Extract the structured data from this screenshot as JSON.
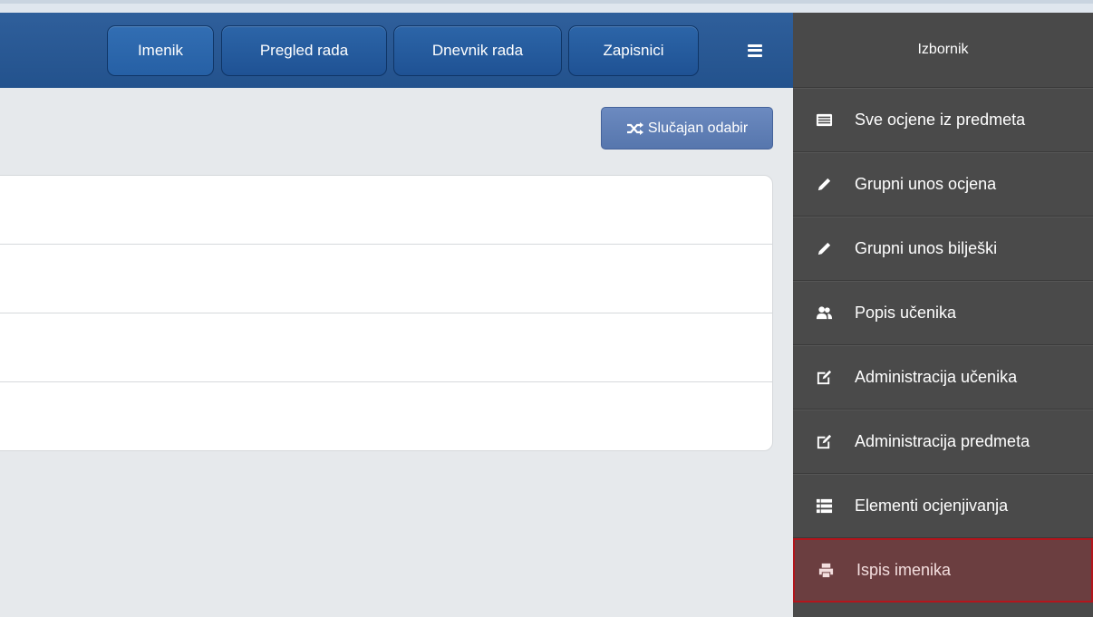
{
  "nav": {
    "buttons": [
      {
        "label": "Imenik"
      },
      {
        "label": "Pregled rada"
      },
      {
        "label": "Dnevnik rada"
      },
      {
        "label": "Zapisnici"
      }
    ],
    "menu_icon": "hamburger-icon"
  },
  "toolbar": {
    "random_label": "Slučajan odabir",
    "random_icon": "shuffle-icon"
  },
  "sidebar": {
    "title": "Izbornik",
    "items": [
      {
        "label": "Sve ocjene iz predmeta",
        "icon": "list-alt-icon"
      },
      {
        "label": "Grupni unos ocjena",
        "icon": "pencil-icon"
      },
      {
        "label": "Grupni unos bilješki",
        "icon": "pencil-icon"
      },
      {
        "label": "Popis učenika",
        "icon": "users-icon"
      },
      {
        "label": "Administracija učenika",
        "icon": "edit-icon"
      },
      {
        "label": "Administracija predmeta",
        "icon": "edit-icon"
      },
      {
        "label": "Elementi ocjenjivanja",
        "icon": "list-icon"
      },
      {
        "label": "Ispis imenika",
        "icon": "print-icon",
        "selected": true
      }
    ]
  },
  "colors": {
    "header": "#23528d",
    "sidebar": "#4a4a4a",
    "selected_border": "#b3151c",
    "random_button": "#5676ad"
  }
}
